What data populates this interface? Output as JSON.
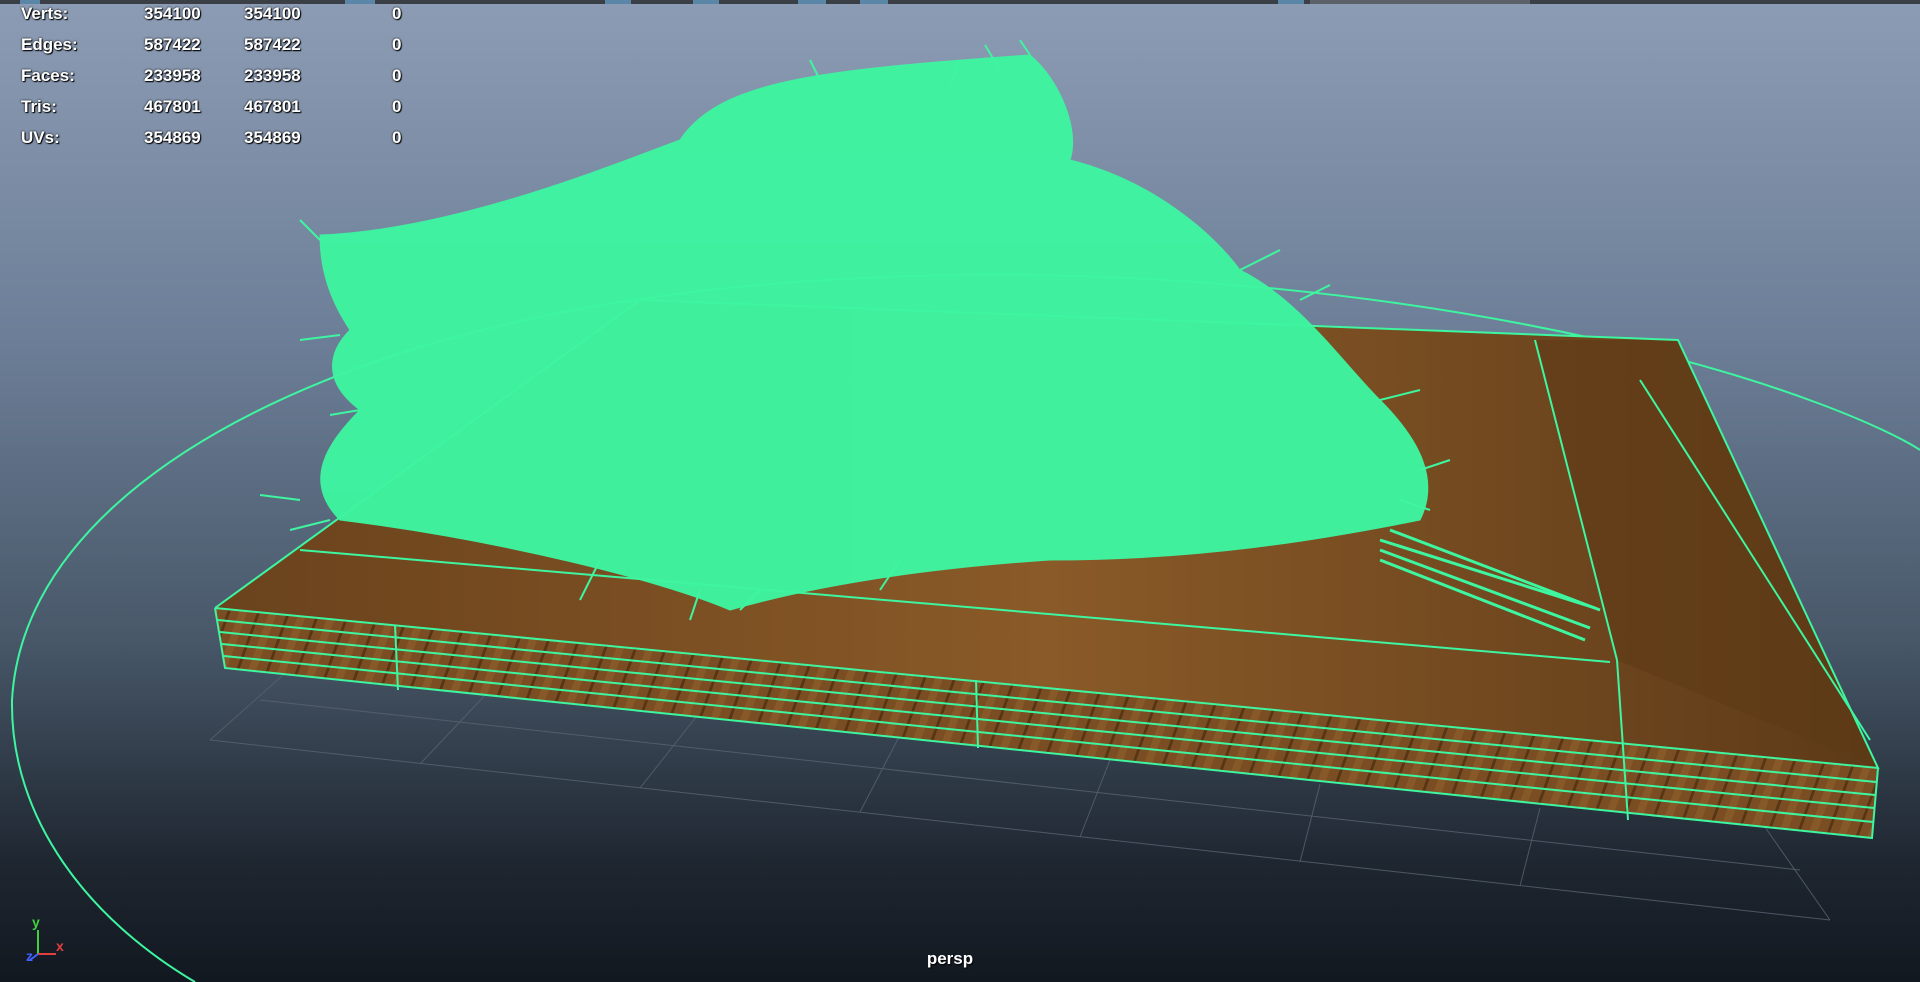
{
  "stats": {
    "rows": [
      {
        "label": "Verts:",
        "total": "354100",
        "selected": "354100",
        "extra": "0"
      },
      {
        "label": "Edges:",
        "total": "587422",
        "selected": "587422",
        "extra": "0"
      },
      {
        "label": "Faces:",
        "total": "233958",
        "selected": "233958",
        "extra": "0"
      },
      {
        "label": "Tris:",
        "total": "467801",
        "selected": "467801",
        "extra": "0"
      },
      {
        "label": "UVs:",
        "total": "354869",
        "selected": "354869",
        "extra": "0"
      }
    ]
  },
  "viewport": {
    "camera_label": "persp",
    "axis": {
      "y": "y",
      "x": "x",
      "z": "z"
    },
    "colors": {
      "wireframe": "#3ef5a0",
      "wood": "#7a4e22",
      "bg_top": "#8c9cb4",
      "bg_bottom": "#121820",
      "axis_x": "#e04040",
      "axis_y": "#40d040",
      "axis_z": "#4060ff"
    }
  }
}
